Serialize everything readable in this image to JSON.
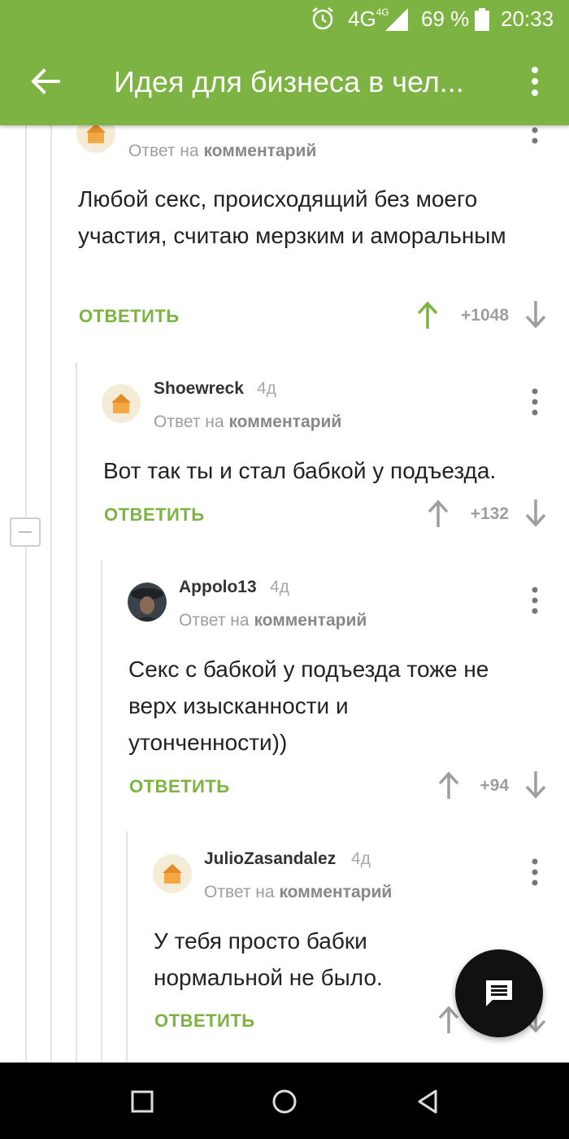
{
  "status_bar": {
    "network": "4G",
    "network_sup": "4G",
    "battery": "69 %",
    "time": "20:33"
  },
  "app_bar": {
    "title": "Идея для бизнеса в чел..."
  },
  "comments": [
    {
      "reply_prefix": "Ответ на",
      "reply_target": "комментарий",
      "text": "Любой секс, происходящий без моего участия, считаю мерзким и аморальным",
      "reply_label": "ОТВЕТИТЬ",
      "score": "+1048"
    },
    {
      "author": "Shoewreck",
      "age": "4д",
      "reply_prefix": "Ответ на",
      "reply_target": "комментарий",
      "text": "Вот так ты и стал бабкой у подъезда.",
      "reply_label": "ОТВЕТИТЬ",
      "score": "+132"
    },
    {
      "author": "Appolo13",
      "age": "4д",
      "reply_prefix": "Ответ на",
      "reply_target": "комментарий",
      "text": "Секс с бабкой у подъезда тоже не верх изысканности и утонченности))",
      "reply_label": "ОТВЕТИТЬ",
      "score": "+94"
    },
    {
      "author": "JulioZasandalez",
      "age": "4д",
      "reply_prefix": "Ответ на",
      "reply_target": "комментарий",
      "text": "У тебя просто бабки нормальной не было.",
      "reply_label": "ОТВЕТИТЬ"
    }
  ],
  "colors": {
    "accent": "#7cb342",
    "upvote_active": "#7cb342",
    "vote_neutral": "#9e9e9e"
  },
  "icons": [
    "alarm-icon",
    "signal-icon",
    "battery-icon",
    "back-arrow-icon",
    "more-vert-icon",
    "upvote-icon",
    "downvote-icon",
    "collapse-icon",
    "comment-fab-icon",
    "nav-recents-icon",
    "nav-home-icon",
    "nav-back-icon"
  ]
}
